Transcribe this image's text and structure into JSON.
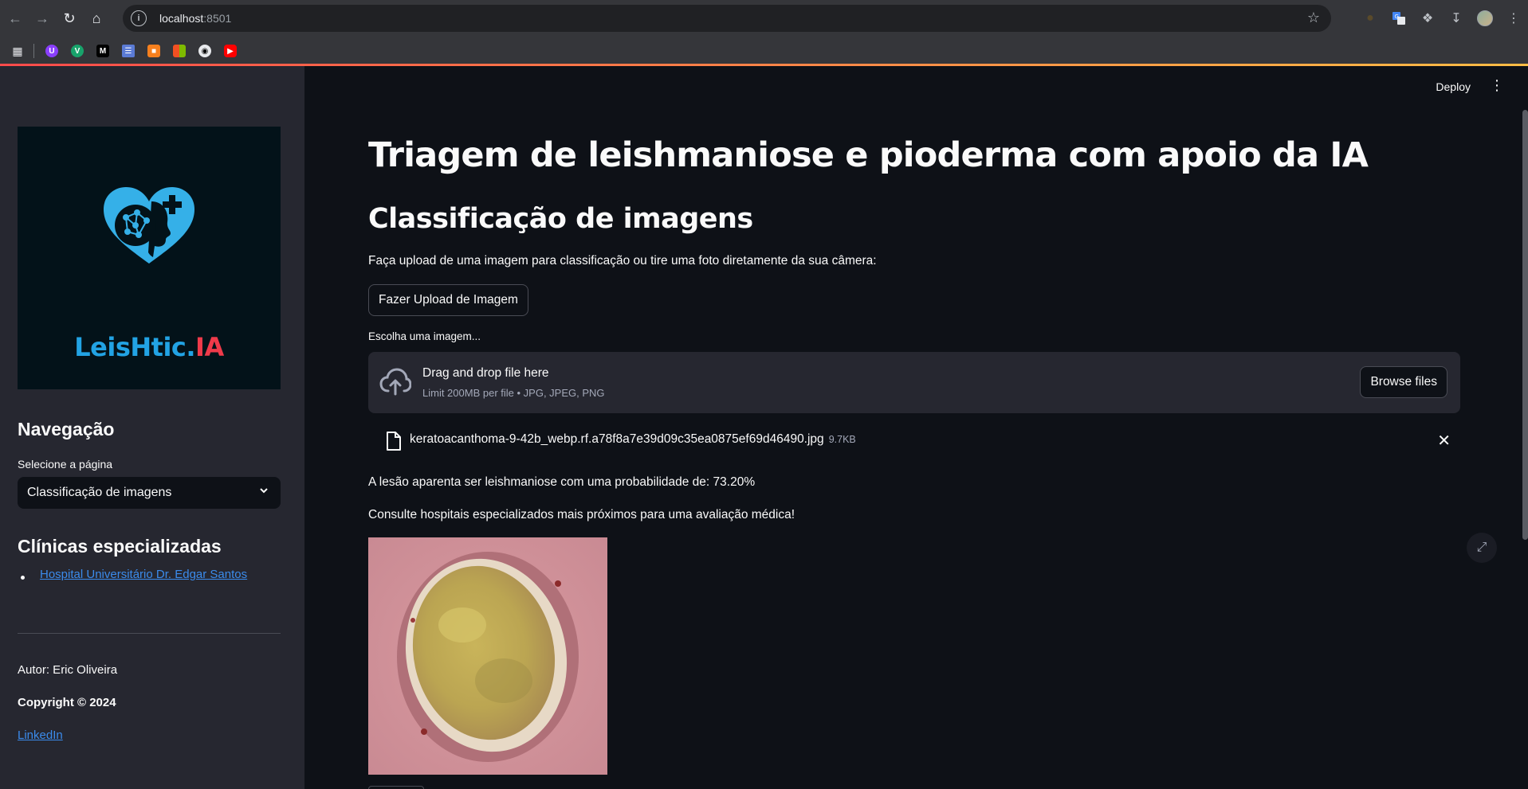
{
  "browser": {
    "url_host": "localhost",
    "url_port": ":8501",
    "bookmarks": [
      "bookmark-u",
      "bookmark-v",
      "bookmark-m",
      "bookmark-layers",
      "bookmark-box",
      "bookmark-microsoft",
      "bookmark-github",
      "bookmark-youtube"
    ]
  },
  "sidebar": {
    "logo": {
      "text_part1": "LeisHtic.",
      "text_part2": "IA"
    },
    "nav_heading": "Navegação",
    "select_label": "Selecione a página",
    "select_value": "Classificação de imagens",
    "clinics_heading": "Clínicas especializadas",
    "clinics": [
      "Hospital Universitário Dr. Edgar Santos"
    ],
    "author": "Autor: Eric Oliveira",
    "copyright": "Copyright © 2024",
    "linkedin": "LinkedIn"
  },
  "header": {
    "deploy_label": "Deploy"
  },
  "main": {
    "title": "Triagem de leishmaniose e pioderma com apoio da IA",
    "subtitle": "Classificação de imagens",
    "instruction": "Faça upload de uma imagem para classificação ou tire uma foto diretamente da sua câmera:",
    "upload_button": "Fazer Upload de Imagem",
    "uploader_label": "Escolha uma imagem...",
    "dropzone_title": "Drag and drop file here",
    "dropzone_sub": "Limit 200MB per file • JPG, JPEG, PNG",
    "browse_button": "Browse files",
    "file_name": "keratoacanthoma-9-42b_webp.rf.a78f8a7e39d09c35ea0875ef69d46490.jpg",
    "file_size": "9.7KB",
    "result": "A lesão aparenta ser leishmaniose com uma probabilidade de: 73.20%",
    "advice": "Consulte hospitais especializados mais próximos para uma avaliação médica!"
  },
  "colors": {
    "accent_gradient_start": "#ff4b4b",
    "accent_gradient_end": "#ffbd45",
    "link": "#3b8beb",
    "logo_blue": "#22a3e4",
    "logo_red": "#ef3a4a"
  }
}
